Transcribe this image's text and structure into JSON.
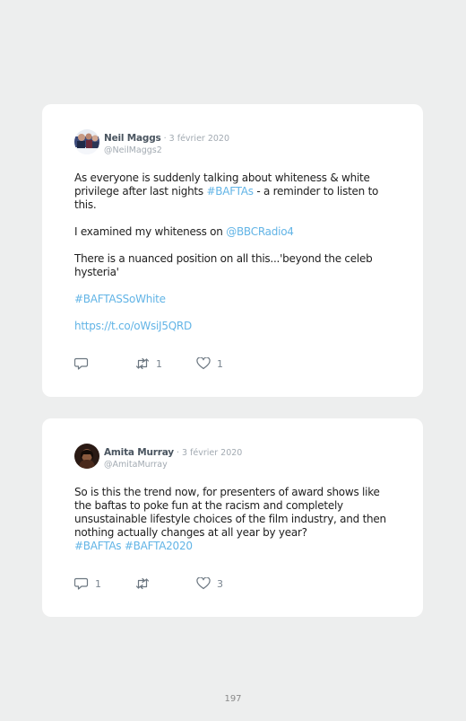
{
  "tweets": [
    {
      "name": "Neil Maggs",
      "sep": " · ",
      "date": "3 février 2020",
      "handle": "@NeilMaggs2",
      "p1_a": "As everyone is suddenly talking about whiteness & white privilege after last nights ",
      "p1_tag": "#BAFTAs",
      "p1_b": " - a reminder to listen to this.",
      "p2_a": "I examined my whiteness on ",
      "p2_mention": "@BBCRadio4",
      "p3": "There is a nuanced position on all this...'beyond the celeb hysteria'",
      "p4_tag": "#BAFTASSoWhite",
      "p5_link": "https://t.co/oWsiJ5QRD",
      "replies": "",
      "retweets": "1",
      "likes": "1"
    },
    {
      "name": "Amita Murray",
      "sep": " · ",
      "date": "3 février 2020",
      "handle": "@AmitaMurray",
      "text": "So is this the trend now, for presenters of award shows like the baftas to poke fun at the racism and completely unsustainable lifestyle choices of the film industry, and then nothing actually changes at all year by year?",
      "tag1": "#BAFTAs",
      "tag2": "#BAFTA2020",
      "replies": "1",
      "retweets": "",
      "likes": "3"
    }
  ],
  "page_number": "197",
  "icons": {
    "reply": "reply-icon",
    "retweet": "retweet-icon",
    "like": "heart-icon"
  },
  "colors": {
    "link": "#62b4e6",
    "name": "#4a5560",
    "meta": "#a2aab2"
  }
}
